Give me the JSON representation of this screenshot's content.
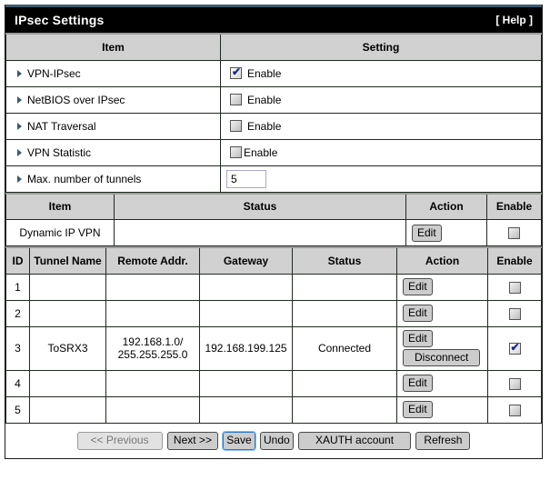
{
  "header": {
    "title": "IPsec Settings",
    "help_label": "[ Help ]"
  },
  "settings_table": {
    "columns": [
      "Item",
      "Setting"
    ],
    "rows": [
      {
        "label": "VPN-IPsec",
        "type": "checkbox",
        "checked": true,
        "option_label": "Enable"
      },
      {
        "label": "NetBIOS over IPsec",
        "type": "checkbox",
        "checked": false,
        "option_label": "Enable"
      },
      {
        "label": "NAT Traversal",
        "type": "checkbox",
        "checked": false,
        "option_label": "Enable"
      },
      {
        "label": "VPN Statistic",
        "type": "checkbox",
        "checked": false,
        "option_label": "Enable"
      },
      {
        "label": "Max. number of tunnels",
        "type": "input",
        "value": "5"
      }
    ]
  },
  "dynamic_table": {
    "columns": [
      "Item",
      "Status",
      "Action",
      "Enable"
    ],
    "row": {
      "item": "Dynamic IP VPN",
      "status": "",
      "edit_label": "Edit",
      "enabled": false
    }
  },
  "tunnel_table": {
    "columns": [
      "ID",
      "Tunnel Name",
      "Remote Addr.",
      "Gateway",
      "Status",
      "Action",
      "Enable"
    ],
    "rows": [
      {
        "id": "1",
        "name": "",
        "remote_line1": "",
        "remote_line2": "",
        "gateway": "",
        "status": "",
        "edit_label": "Edit",
        "disconnect_label": "",
        "enabled": false
      },
      {
        "id": "2",
        "name": "",
        "remote_line1": "",
        "remote_line2": "",
        "gateway": "",
        "status": "",
        "edit_label": "Edit",
        "disconnect_label": "",
        "enabled": false
      },
      {
        "id": "3",
        "name": "ToSRX3",
        "remote_line1": "192.168.1.0/",
        "remote_line2": "255.255.255.0",
        "gateway": "192.168.199.125",
        "status": "Connected",
        "edit_label": "Edit",
        "disconnect_label": "Disconnect",
        "enabled": true
      },
      {
        "id": "4",
        "name": "",
        "remote_line1": "",
        "remote_line2": "",
        "gateway": "",
        "status": "",
        "edit_label": "Edit",
        "disconnect_label": "",
        "enabled": false
      },
      {
        "id": "5",
        "name": "",
        "remote_line1": "",
        "remote_line2": "",
        "gateway": "",
        "status": "",
        "edit_label": "Edit",
        "disconnect_label": "",
        "enabled": false
      }
    ]
  },
  "footer": {
    "previous_label": "<< Previous",
    "next_label": "Next >>",
    "save_label": "Save",
    "undo_label": "Undo",
    "xauth_label": "XAUTH account",
    "refresh_label": "Refresh"
  }
}
